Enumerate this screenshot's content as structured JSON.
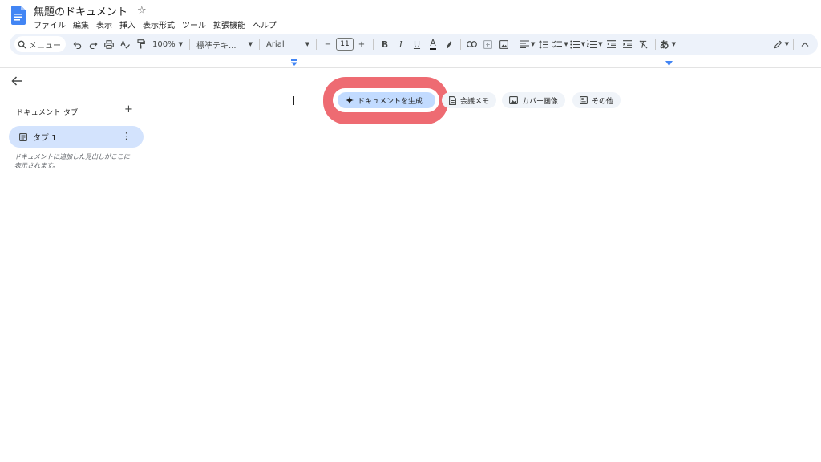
{
  "header": {
    "doc_title": "無題のドキュメント",
    "menu": [
      "ファイル",
      "編集",
      "表示",
      "挿入",
      "表示形式",
      "ツール",
      "拡張機能",
      "ヘルプ"
    ]
  },
  "toolbar": {
    "search_label": "メニュー",
    "zoom": "100%",
    "style": "標準テキ...",
    "font": "Arial",
    "font_size": "11",
    "minus": "−",
    "plus": "+",
    "bold": "B",
    "italic": "I",
    "underline": "U",
    "text_color": "A",
    "input_mode": "あ"
  },
  "sidebar": {
    "tabs_header": "ドキュメント タブ",
    "add_label": "+",
    "tab_label": "タブ 1",
    "hint": "ドキュメントに追加した見出しがここに表示されます。"
  },
  "chips": {
    "generate": "ドキュメントを生成",
    "meeting_notes": "会議メモ",
    "cover_image": "カバー画像",
    "other": "その他"
  },
  "colors": {
    "accent_blue": "#c2dbff",
    "highlight": "#ee6b72",
    "toolbar_bg": "#edf2fa",
    "tab_selected": "#d3e3fd"
  },
  "icons": {
    "logo": "google-docs-icon",
    "star": "star-icon",
    "back": "arrow-left-icon",
    "generate": "sparkle-icon",
    "meeting": "document-icon",
    "cover": "image-icon",
    "other": "template-icon"
  }
}
